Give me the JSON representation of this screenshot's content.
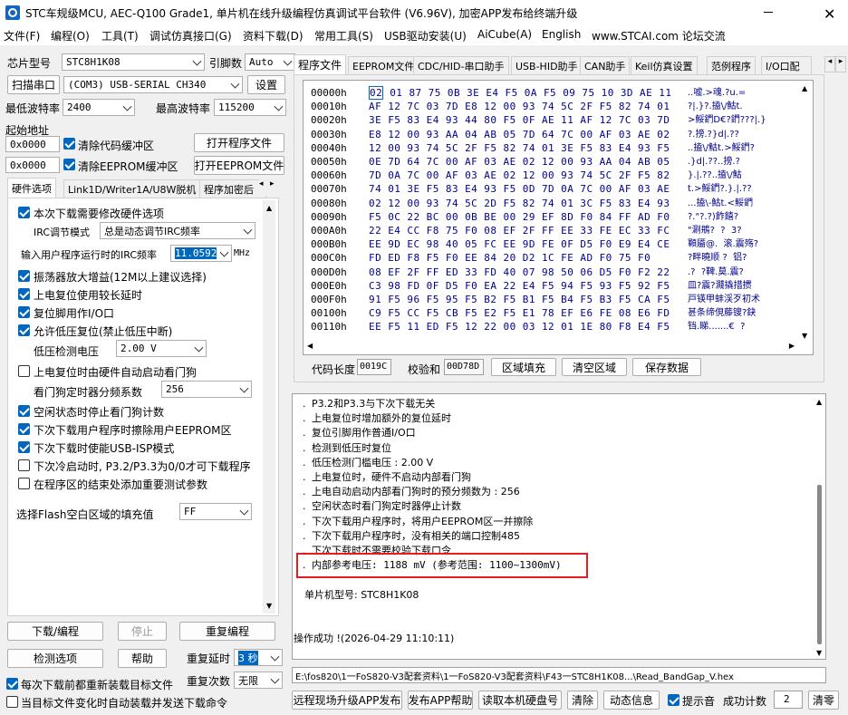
{
  "window": {
    "title": "STC车规级MCU, AEC-Q100 Grade1, 单片机在线升级编程仿真调试平台软件 (V6.96V), 加密APP发布给终端升级"
  },
  "menu": [
    "文件(F)",
    "编程(O)",
    "工具(T)",
    "调试仿真接口(G)",
    "资料下载(D)",
    "常用工具(S)",
    "USB驱动安装(U)",
    "AiCube(A)",
    "English",
    "www.STCAI.com 论坛交流"
  ],
  "left": {
    "chip_label": "芯片型号",
    "chip_value": "STC8H1K08",
    "pins_label": "引脚数",
    "pins_value": "Auto",
    "scan_button": "扫描串口",
    "port_value": "(COM3) USB-SERIAL CH340",
    "settings_button": "设置",
    "min_baud_label": "最低波特率",
    "min_baud_value": "2400",
    "max_baud_label": "最高波特率",
    "max_baud_value": "115200",
    "start_addr_label": "起始地址",
    "addr1": "0x0000",
    "clear_code_label": "清除代码缓冲区",
    "open_prog_button": "打开程序文件",
    "addr2": "0x0000",
    "clear_eeprom_label": "清除EEPROM缓冲区",
    "open_eeprom_button": "打开EEPROM文件",
    "tabs": [
      "硬件选项",
      "Link1D/Writer1A/U8W脱机",
      "程序加密后"
    ],
    "options": {
      "o1": "本次下载需要修改硬件选项",
      "irc_mode_label": "IRC调节模式",
      "irc_mode_value": "总是动态调节IRC频率",
      "irc_freq_label": "输入用户程序运行时的IRC频率",
      "irc_freq_value": "11.0592",
      "irc_unit": "MHz",
      "o2": "振荡器放大增益(12M以上建议选择)",
      "o3": "上电复位使用较长延时",
      "o4": "复位脚用作I/O口",
      "o5": "允许低压复位(禁止低压中断)",
      "lvd_label": "低压检测电压",
      "lvd_value": "2.00 V",
      "o6": "上电复位时由硬件自动启动看门狗",
      "wdt_label": "看门狗定时器分频系数",
      "wdt_value": "256",
      "o7": "空闲状态时停止看门狗计数",
      "o8": "下次下载用户程序时擦除用户EEPROM区",
      "o9": "下次下载时使能USB-ISP模式",
      "o10": "下次冷启动时, P3.2/P3.3为0/0才可下载程序",
      "o11": "在程序区的结束处添加重要测试参数",
      "fill_label": "选择Flash空白区域的填充值",
      "fill_value": "FF"
    },
    "download_button": "下载/编程",
    "stop_button": "停止",
    "reprogram_button": "重复编程",
    "check_button": "检测选项",
    "help_button": "帮助",
    "delay_label": "重复延时",
    "delay_value": "3 秒",
    "count_label": "重复次数",
    "count_value": "无限",
    "reload_label": "每次下载前都重新装载目标文件",
    "auto_send_label": "当目标文件变化时自动装载并发送下载命令"
  },
  "right": {
    "tabs": [
      "程序文件",
      "EEPROM文件",
      "CDC/HID-串口助手",
      "USB-HID助手",
      "CAN助手",
      "Keil仿真设置",
      "范例程序",
      "I/O口配"
    ],
    "hex_rows": [
      {
        "addr": "00000h",
        "bytes": "02 01 87 75 0B 3E E4 F5 0A F5 09 75 10 3D AE 11",
        "ascii": "..嘘.>魂.?u.="
      },
      {
        "addr": "00010h",
        "bytes": "AF 12 7C 03 7D E8 12 00 93 74 5C 2F F5 82 74 01",
        "ascii": "?|.}?.搕\\/鮕t."
      },
      {
        "addr": "00020h",
        "bytes": "3E F5 83 E4 93 44 80 F5 0F AE 11 AF 12 7C 03 7D",
        "ascii": ">鮾鍆D€?鍆???|.}"
      },
      {
        "addr": "00030h",
        "bytes": "E8 12 00 93 AA 04 AB 05 7D 64 7C 00 AF 03 AE 02",
        "ascii": "?.搒.?}d|.??"
      },
      {
        "addr": "00040h",
        "bytes": "12 00 93 74 5C 2F F5 82 74 01 3E F5 83 E4 93 F5",
        "ascii": "..搕\\/鮕t.>鮾鍆?"
      },
      {
        "addr": "00050h",
        "bytes": "0E 7D 64 7C 00 AF 03 AE 02 12 00 93 AA 04 AB 05",
        "ascii": ".}d|.??..搒.?"
      },
      {
        "addr": "00060h",
        "bytes": "7D 0A 7C 00 AF 03 AE 02 12 00 93 74 5C 2F F5 82",
        "ascii": "}.|.??..搕\\/鮕"
      },
      {
        "addr": "00070h",
        "bytes": "74 01 3E F5 83 E4 93 F5 0D 7D 0A 7C 00 AF 03 AE",
        "ascii": "t.>鮾鍆?.}.|.??"
      },
      {
        "addr": "00080h",
        "bytes": "02 12 00 93 74 5C 2D F5 82 74 01 3C F5 83 E4 93",
        "ascii": "...搕\\-鮕t.<鮾鍆"
      },
      {
        "addr": "00090h",
        "bytes": "F5 0C 22 BC 00 0B BE 00 29 EF 8D F0 84 FF AD F0",
        "ascii": "?.\"?.?)飵饎?"
      },
      {
        "addr": "000A0h",
        "bytes": "22 E4 CC F8 75 F0 08 EF 2F FF EE 33 FE EC 33 FC",
        "ascii": "\"涮鴘?  ?  3?"
      },
      {
        "addr": "000B0h",
        "bytes": "EE 9D EC 98 40 05 FC EE 9D FE 0F D5 F0 E9 E4 CE",
        "ascii": "顐靥@.  滚.震殇?"
      },
      {
        "addr": "000C0h",
        "bytes": "FD ED F8 F5 F0 EE 84 20 D2 1C FE AD F0 75 F0",
        "ascii": "?畔曉顺 ?  铝?"
      },
      {
        "addr": "000D0h",
        "bytes": "08 EF 2F FF ED 33 FD 40 07 98 50 06 D5 F0 F2 22",
        "ascii": ".?  ?鞞.莫.震?"
      },
      {
        "addr": "000E0h",
        "bytes": "C3 98 FD 0F D5 F0 EA 22 E4 F5 94 F5 93 F5 92 F5",
        "ascii": "皿?震?濺撬措掼"
      },
      {
        "addr": "000F0h",
        "bytes": "91 F5 96 F5 95 F5 B2 F5 B1 F5 B4 F5 B3 F5 CA F5",
        "ascii": "戸锳甲蚌渓歹初术"
      },
      {
        "addr": "00100h",
        "bytes": "C9 F5 CC F5 CB F5 E2 F5 E1 78 EF E6 FE 08 E6 FD",
        "ascii": "甚条缔俔藤锼?鈌"
      },
      {
        "addr": "00110h",
        "bytes": "EE F5 11 ED F5 12 22 00 03 12 01 1E 80 F8 E4 F5",
        "ascii": "铛.睇.......€  ?"
      }
    ],
    "code_len_label": "代码长度",
    "code_len_value": "0019C",
    "checksum_label": "校验和",
    "checksum_value": "00D78D",
    "fill_area_button": "区域填充",
    "clear_area_button": "清空区域",
    "save_data_button": "保存数据",
    "log": [
      "P3.2和P3.3与下次下载无关",
      "上电复位时增加额外的复位延时",
      "复位引脚用作普通I/O口",
      "检测到低压时复位",
      "低压检测门槛电压 : 2.00 V",
      "上电复位时，硬件不启动内部看门狗",
      "上电自动启动内部看门狗时的预分频数为 : 256",
      "空闲状态时看门狗定时器停止计数",
      "下次下载用户程序时，将用户EEPROM区一并擦除",
      "下次下载用户程序时，没有相关的端口控制485",
      "下次下载时不需要校验下载口令",
      "内部参考电压: 1188 mV (参考范围: 1100~1300mV)"
    ],
    "chip_model_line": "单片机型号: STC8H1K08",
    "success_line": "操作成功 !(2026-04-29 11:10:11)",
    "file_path": "E:\\fos820\\1一FoS820-V3配套资料\\1一FoS820-V3配套资料\\F43一STC8H1K08...\\Read_BandGap_V.hex",
    "bottom": {
      "remote_button": "远程现场升级APP发布",
      "publish_help_button": "发布APP帮助",
      "read_id_button": "读取本机硬盘号",
      "clear_button": "清除",
      "dynamic_button": "动态信息",
      "beep_label": "提示音",
      "success_count_label": "成功计数",
      "success_count_value": "2",
      "clear_count_button": "清零"
    }
  },
  "colors": {
    "highlight_box": "#e02020",
    "selection": "#0067c0",
    "hex_text": "#00008b"
  }
}
